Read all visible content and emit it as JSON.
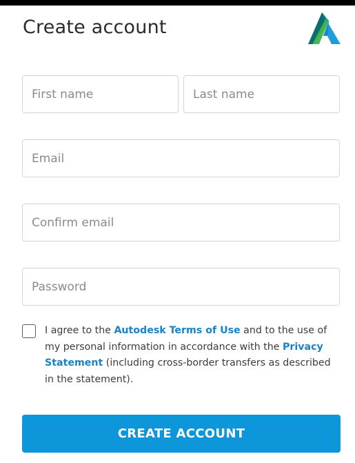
{
  "header": {
    "title": "Create account",
    "logo_icon": "autodesk-logo-icon"
  },
  "form": {
    "first_name": {
      "value": "",
      "placeholder": "First name"
    },
    "last_name": {
      "value": "",
      "placeholder": "Last name"
    },
    "email": {
      "value": "",
      "placeholder": "Email"
    },
    "confirm_email": {
      "value": "",
      "placeholder": "Confirm email"
    },
    "password": {
      "value": "",
      "placeholder": "Password"
    }
  },
  "consent": {
    "checked": false,
    "text_before": "I agree to the ",
    "terms_link": "Autodesk Terms of Use",
    "text_middle": " and to the use of my personal information in accordance with the ",
    "privacy_link": "Privacy Statement",
    "text_after": " (including cross-border transfers as described in the statement)."
  },
  "actions": {
    "create_label": "CREATE ACCOUNT"
  },
  "colors": {
    "accent": "#0d96d9",
    "link": "#1a82c4",
    "topbar": "#000000"
  }
}
